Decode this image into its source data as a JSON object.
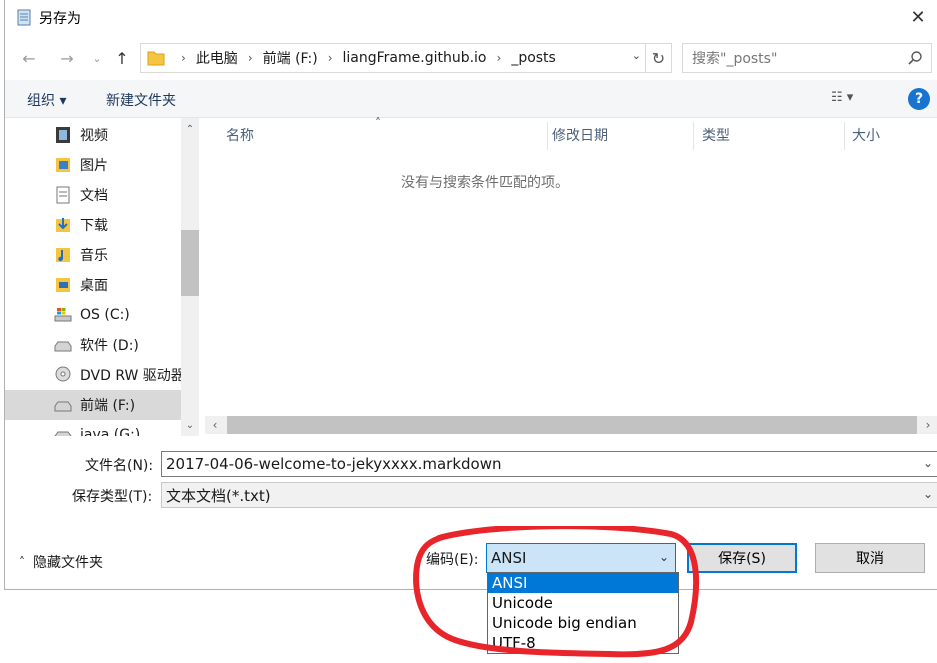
{
  "window": {
    "title": "另存为",
    "close_glyph": "✕"
  },
  "nav": {
    "back_glyph": "←",
    "forward_glyph": "→",
    "history_glyph": "⌄",
    "up_glyph": "↑"
  },
  "address": {
    "crumbs": [
      "此电脑",
      "前端 (F:)",
      "liangFrame.github.io",
      "_posts"
    ],
    "separator": "›",
    "dropdown_glyph": "⌄",
    "refresh_glyph": "↻"
  },
  "search": {
    "placeholder": "搜索\"_posts\""
  },
  "toolbar": {
    "organize_label": "组织 ▾",
    "new_folder_label": "新建文件夹",
    "view_glyph": "☷ ▾",
    "help_glyph": "?"
  },
  "sidebar": {
    "items": [
      {
        "label": "视频",
        "icon": "video-folder-icon"
      },
      {
        "label": "图片",
        "icon": "pictures-folder-icon"
      },
      {
        "label": "文档",
        "icon": "documents-folder-icon"
      },
      {
        "label": "下载",
        "icon": "downloads-folder-icon"
      },
      {
        "label": "音乐",
        "icon": "music-folder-icon"
      },
      {
        "label": "桌面",
        "icon": "desktop-folder-icon"
      },
      {
        "label": "OS (C:)",
        "icon": "system-drive-icon"
      },
      {
        "label": "软件 (D:)",
        "icon": "drive-icon"
      },
      {
        "label": "DVD RW 驱动器",
        "icon": "dvd-drive-icon"
      },
      {
        "label": "前端 (F:)",
        "icon": "drive-icon",
        "selected": true
      },
      {
        "label": "java (G:)",
        "icon": "drive-icon"
      }
    ],
    "scroll_up_glyph": "⌃",
    "scroll_down_glyph": "⌄"
  },
  "file_list": {
    "columns": [
      "名称",
      "修改日期",
      "类型",
      "大小"
    ],
    "sort_glyph": "˄",
    "empty_message": "没有与搜索条件匹配的项。",
    "scroll_left_glyph": "‹",
    "scroll_right_glyph": "›"
  },
  "form": {
    "filename_label": "文件名(N):",
    "filename_value": "2017-04-06-welcome-to-jekyxxxx.markdown",
    "filetype_label": "保存类型(T):",
    "filetype_value": "文本文档(*.txt)",
    "dropdown_glyph": "⌄"
  },
  "footer": {
    "hide_folders_label": "隐藏文件夹",
    "hide_folders_glyph": "˄",
    "encoding_label": "编码(E):",
    "encoding_value": "ANSI",
    "encoding_glyph": "⌄",
    "encoding_options": [
      "ANSI",
      "Unicode",
      "Unicode big endian",
      "UTF-8"
    ],
    "save_label": "保存(S)",
    "cancel_label": "取消"
  },
  "colors": {
    "accent": "#0078d7",
    "annotation": "#e8252b",
    "selection": "#cce4f7"
  }
}
